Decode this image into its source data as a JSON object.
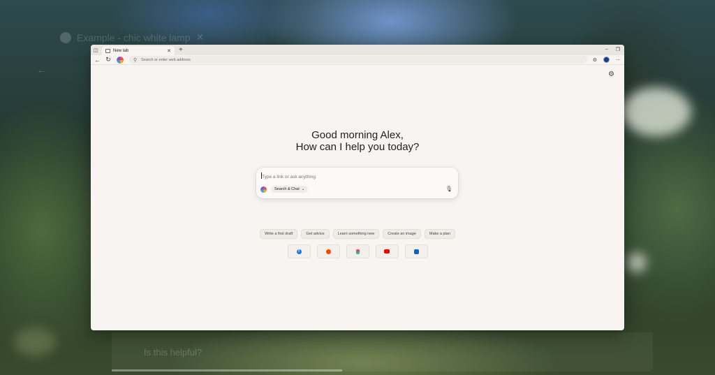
{
  "background": {
    "ghost_tab_title": "Example - chic white lamp",
    "ghost_helpful_text": "Is this helpful?"
  },
  "browser": {
    "tab": {
      "title": "New tab"
    },
    "omnibox": {
      "placeholder": "Search or enter web address"
    },
    "colors": {
      "window_bg": "#f7f4f1",
      "tabbar_bg": "#e9e6e2",
      "avatar": "#1e3d7a"
    }
  },
  "newtab": {
    "greeting_line1": "Good morning Alex,",
    "greeting_line2": "How can I help you today?",
    "chat": {
      "placeholder": "Type a link or ask anything",
      "mode_label": "Search & Chat"
    },
    "chips": [
      {
        "label": "Write a first draft"
      },
      {
        "label": "Get advice"
      },
      {
        "label": "Learn something new"
      },
      {
        "label": "Create an image"
      },
      {
        "label": "Make a plan"
      }
    ],
    "shortcuts": [
      {
        "name": "facebook-icon",
        "color": "#1877f2"
      },
      {
        "name": "reddit-icon",
        "color": "#ff4500"
      },
      {
        "name": "figma-icon",
        "color": "#a259ff"
      },
      {
        "name": "youtube-icon",
        "color": "#ff0000"
      },
      {
        "name": "linkedin-icon",
        "color": "#0a66c2"
      }
    ]
  }
}
